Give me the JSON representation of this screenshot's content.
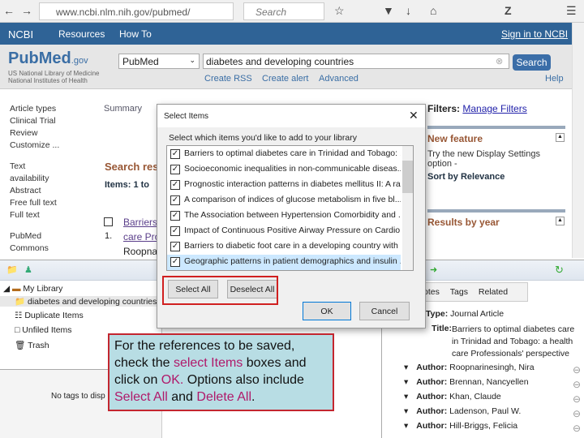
{
  "browser": {
    "url": "www.ncbi.nlm.nih.gov/pubmed/",
    "search_placeholder": "Search"
  },
  "ncbi": {
    "logo": "NCBI",
    "resources": "Resources",
    "howto": "How To",
    "signin": "Sign in to NCBI"
  },
  "pubmed": {
    "logo": "PubMed",
    "logo_suffix": ".gov",
    "org1": "US National Library of Medicine",
    "org2": "National Institutes of Health",
    "db": "PubMed",
    "query": "diabetes and developing countries",
    "search": "Search",
    "create_rss": "Create RSS",
    "create_alert": "Create alert",
    "advanced": "Advanced",
    "help": "Help"
  },
  "sidebar": {
    "article_types": "Article types",
    "clinical_trial": "Clinical Trial",
    "review": "Review",
    "customize": "Customize ...",
    "text_avail": "Text availability",
    "abstract": "Abstract",
    "free_full": "Free full text",
    "full_text": "Full text",
    "pubmed_commons": "PubMed Commons"
  },
  "results": {
    "summary": "Summary",
    "title": "Search res",
    "items": "Items: 1 to",
    "num": "1.",
    "link1": "Barriers",
    "link2": "care Pro",
    "authors": "Roopna"
  },
  "right": {
    "filters": "Filters:",
    "manage": "Manage Filters",
    "new_feature": "New feature",
    "nf_text": "Try the new Display Settings option -",
    "sort": "Sort by Relevance",
    "results_year": "Results by year"
  },
  "dialog": {
    "title": "Select Items",
    "prompt": "Select which items you'd like to add to your library",
    "items": [
      "Barriers to optimal diabetes care in Trinidad and Tobago: ...",
      "Socioeconomic inequalities in non-communicable diseas...",
      "Prognostic interaction patterns in diabetes mellitus II: A ra...",
      "A comparison of indices of glucose metabolism in five bl...",
      "The Association between Hypertension Comorbidity and ...",
      "Impact of Continuous Positive Airway Pressure on Cardio...",
      "Barriers to diabetic foot care in a developing country with ...",
      "Geographic patterns in patient demographics and insulin ..."
    ],
    "select_all": "Select All",
    "deselect_all": "Deselect All",
    "ok": "OK",
    "cancel": "Cancel"
  },
  "zotero": {
    "my_library": "My Library",
    "collection": "diabetes and developing countries",
    "duplicates": "Duplicate Items",
    "unfiled": "Unfiled Items",
    "trash": "Trash",
    "no_tags": "No tags to disp",
    "tabs": [
      "otes",
      "Tags",
      "Related"
    ],
    "item_type_label": "Type:",
    "item_type": "Journal Article",
    "title_label": "Title:",
    "title": "Barriers to optimal diabetes care in Trinidad and Tobago: a health care Professionals' perspective",
    "author_label": "Author:",
    "authors": [
      "Roopnarinesingh, Nira",
      "Brennan, Nancyellen",
      "Khan, Claude",
      "Ladenson, Paul W.",
      "Hill-Briggs, Felicia"
    ]
  },
  "callout": {
    "t1": "For the references to be saved, check the ",
    "h1": "select Items",
    "t2": " boxes and click on ",
    "h2": "OK.",
    "t3": "  Options also include ",
    "h3": "Select All",
    "t4": " and ",
    "h4": "Delete All",
    "t5": "."
  }
}
